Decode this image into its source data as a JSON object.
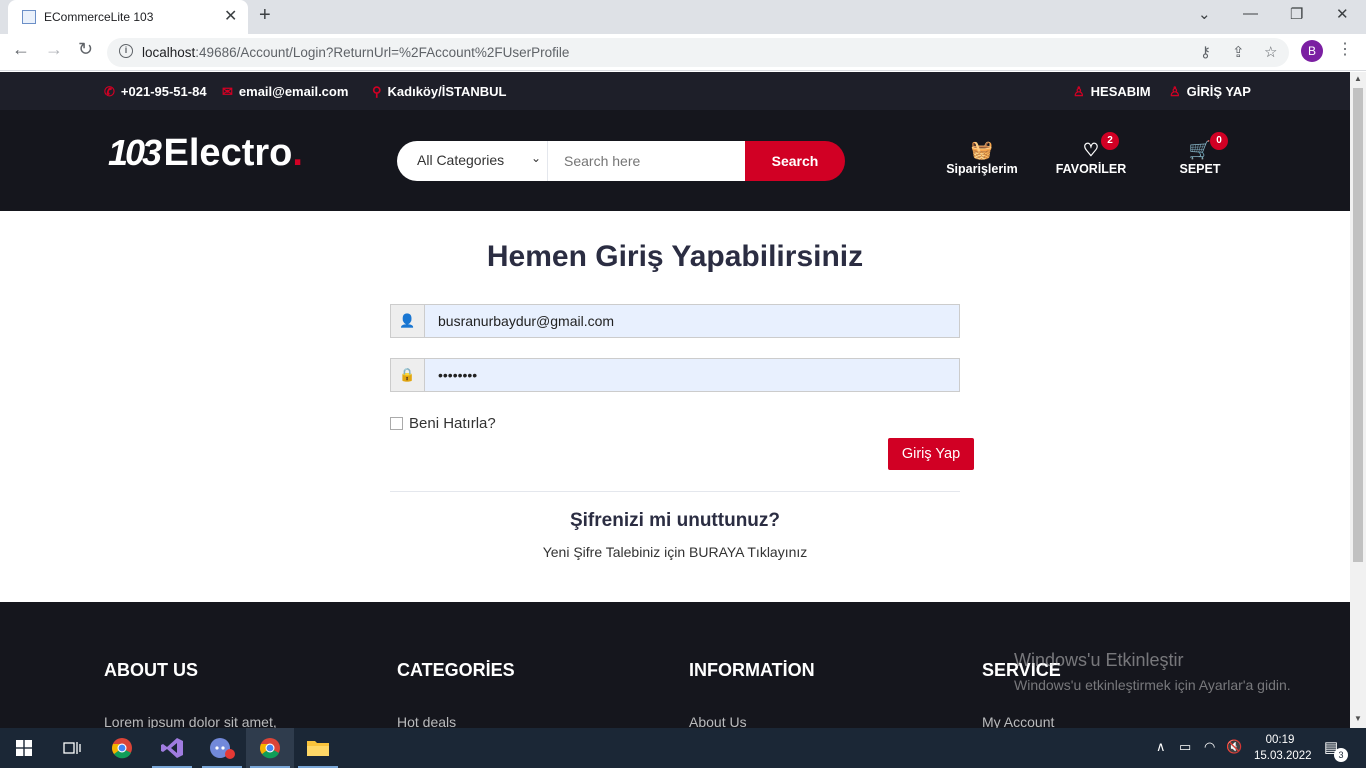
{
  "browser": {
    "tab_title": "ECommerceLite 103",
    "url_host": "localhost",
    "url_rest": ":49686/Account/Login?ReturnUrl=%2FAccount%2FUserProfile",
    "profile_initial": "B"
  },
  "top_header": {
    "phone": "+021-95-51-84",
    "email": "email@email.com",
    "location": "Kadıköy/İSTANBUL",
    "account": "HESABIM",
    "login": "GİRİŞ YAP"
  },
  "header": {
    "logo_number": "103",
    "logo_word": "Electro",
    "logo_dot": ".",
    "category_select": "All Categories",
    "search_placeholder": "Search here",
    "search_button": "Search",
    "orders_label": "Siparişlerim",
    "favorites_label": "FAVORİLER",
    "favorites_count": "2",
    "cart_label": "SEPET",
    "cart_count": "0"
  },
  "login": {
    "title": "Hemen Giriş Yapabilirsiniz",
    "email_value": "busranurbaydur@gmail.com",
    "password_value": "••••••••",
    "remember_label": "Beni Hatırla?",
    "submit_label": "Giriş Yap",
    "forgot_title": "Şifrenizi mi unuttunuz?",
    "forgot_link": "Yeni Şifre Talebiniz için BURAYA Tıklayınız"
  },
  "footer": {
    "columns": [
      {
        "title": "ABOUT US",
        "first_item": "Lorem ipsum dolor sit amet,"
      },
      {
        "title": "CATEGORİES",
        "first_item": "Hot deals"
      },
      {
        "title": "INFORMATİON",
        "first_item": "About Us"
      },
      {
        "title": "SERVICE",
        "first_item": "My Account"
      }
    ]
  },
  "watermark": {
    "line1": "Windows'u Etkinleştir",
    "line2": "Windows'u etkinleştirmek için Ayarlar'a gidin."
  },
  "taskbar": {
    "time": "00:19",
    "date": "15.03.2022",
    "notifications": "3"
  },
  "colors": {
    "accent": "#d10024",
    "header_dark": "#15161d",
    "topbar_dark": "#1e1f29"
  }
}
